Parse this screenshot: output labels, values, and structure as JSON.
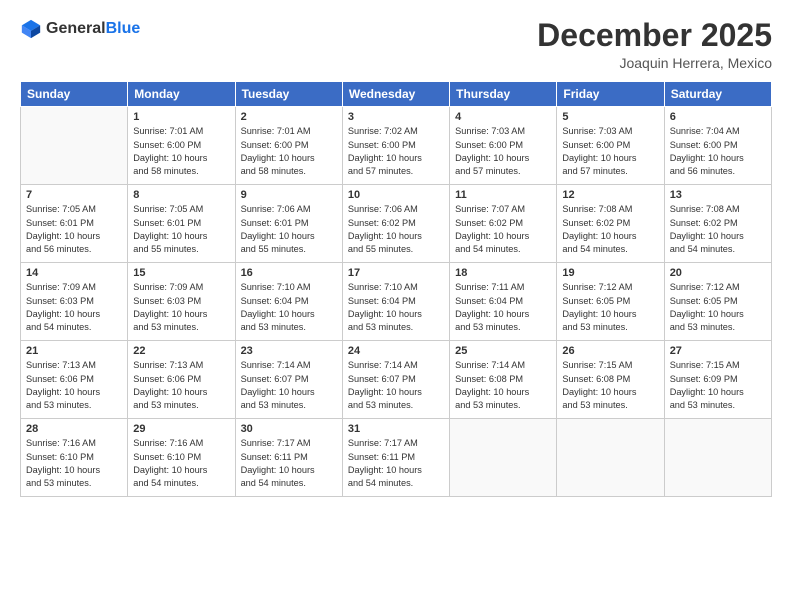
{
  "logo": {
    "general": "General",
    "blue": "Blue"
  },
  "title": "December 2025",
  "subtitle": "Joaquin Herrera, Mexico",
  "weekdays": [
    "Sunday",
    "Monday",
    "Tuesday",
    "Wednesday",
    "Thursday",
    "Friday",
    "Saturday"
  ],
  "weeks": [
    [
      {
        "day": "",
        "info": ""
      },
      {
        "day": "1",
        "info": "Sunrise: 7:01 AM\nSunset: 6:00 PM\nDaylight: 10 hours\nand 58 minutes."
      },
      {
        "day": "2",
        "info": "Sunrise: 7:01 AM\nSunset: 6:00 PM\nDaylight: 10 hours\nand 58 minutes."
      },
      {
        "day": "3",
        "info": "Sunrise: 7:02 AM\nSunset: 6:00 PM\nDaylight: 10 hours\nand 57 minutes."
      },
      {
        "day": "4",
        "info": "Sunrise: 7:03 AM\nSunset: 6:00 PM\nDaylight: 10 hours\nand 57 minutes."
      },
      {
        "day": "5",
        "info": "Sunrise: 7:03 AM\nSunset: 6:00 PM\nDaylight: 10 hours\nand 57 minutes."
      },
      {
        "day": "6",
        "info": "Sunrise: 7:04 AM\nSunset: 6:00 PM\nDaylight: 10 hours\nand 56 minutes."
      }
    ],
    [
      {
        "day": "7",
        "info": "Sunrise: 7:05 AM\nSunset: 6:01 PM\nDaylight: 10 hours\nand 56 minutes."
      },
      {
        "day": "8",
        "info": "Sunrise: 7:05 AM\nSunset: 6:01 PM\nDaylight: 10 hours\nand 55 minutes."
      },
      {
        "day": "9",
        "info": "Sunrise: 7:06 AM\nSunset: 6:01 PM\nDaylight: 10 hours\nand 55 minutes."
      },
      {
        "day": "10",
        "info": "Sunrise: 7:06 AM\nSunset: 6:02 PM\nDaylight: 10 hours\nand 55 minutes."
      },
      {
        "day": "11",
        "info": "Sunrise: 7:07 AM\nSunset: 6:02 PM\nDaylight: 10 hours\nand 54 minutes."
      },
      {
        "day": "12",
        "info": "Sunrise: 7:08 AM\nSunset: 6:02 PM\nDaylight: 10 hours\nand 54 minutes."
      },
      {
        "day": "13",
        "info": "Sunrise: 7:08 AM\nSunset: 6:02 PM\nDaylight: 10 hours\nand 54 minutes."
      }
    ],
    [
      {
        "day": "14",
        "info": "Sunrise: 7:09 AM\nSunset: 6:03 PM\nDaylight: 10 hours\nand 54 minutes."
      },
      {
        "day": "15",
        "info": "Sunrise: 7:09 AM\nSunset: 6:03 PM\nDaylight: 10 hours\nand 53 minutes."
      },
      {
        "day": "16",
        "info": "Sunrise: 7:10 AM\nSunset: 6:04 PM\nDaylight: 10 hours\nand 53 minutes."
      },
      {
        "day": "17",
        "info": "Sunrise: 7:10 AM\nSunset: 6:04 PM\nDaylight: 10 hours\nand 53 minutes."
      },
      {
        "day": "18",
        "info": "Sunrise: 7:11 AM\nSunset: 6:04 PM\nDaylight: 10 hours\nand 53 minutes."
      },
      {
        "day": "19",
        "info": "Sunrise: 7:12 AM\nSunset: 6:05 PM\nDaylight: 10 hours\nand 53 minutes."
      },
      {
        "day": "20",
        "info": "Sunrise: 7:12 AM\nSunset: 6:05 PM\nDaylight: 10 hours\nand 53 minutes."
      }
    ],
    [
      {
        "day": "21",
        "info": "Sunrise: 7:13 AM\nSunset: 6:06 PM\nDaylight: 10 hours\nand 53 minutes."
      },
      {
        "day": "22",
        "info": "Sunrise: 7:13 AM\nSunset: 6:06 PM\nDaylight: 10 hours\nand 53 minutes."
      },
      {
        "day": "23",
        "info": "Sunrise: 7:14 AM\nSunset: 6:07 PM\nDaylight: 10 hours\nand 53 minutes."
      },
      {
        "day": "24",
        "info": "Sunrise: 7:14 AM\nSunset: 6:07 PM\nDaylight: 10 hours\nand 53 minutes."
      },
      {
        "day": "25",
        "info": "Sunrise: 7:14 AM\nSunset: 6:08 PM\nDaylight: 10 hours\nand 53 minutes."
      },
      {
        "day": "26",
        "info": "Sunrise: 7:15 AM\nSunset: 6:08 PM\nDaylight: 10 hours\nand 53 minutes."
      },
      {
        "day": "27",
        "info": "Sunrise: 7:15 AM\nSunset: 6:09 PM\nDaylight: 10 hours\nand 53 minutes."
      }
    ],
    [
      {
        "day": "28",
        "info": "Sunrise: 7:16 AM\nSunset: 6:10 PM\nDaylight: 10 hours\nand 53 minutes."
      },
      {
        "day": "29",
        "info": "Sunrise: 7:16 AM\nSunset: 6:10 PM\nDaylight: 10 hours\nand 54 minutes."
      },
      {
        "day": "30",
        "info": "Sunrise: 7:17 AM\nSunset: 6:11 PM\nDaylight: 10 hours\nand 54 minutes."
      },
      {
        "day": "31",
        "info": "Sunrise: 7:17 AM\nSunset: 6:11 PM\nDaylight: 10 hours\nand 54 minutes."
      },
      {
        "day": "",
        "info": ""
      },
      {
        "day": "",
        "info": ""
      },
      {
        "day": "",
        "info": ""
      }
    ]
  ]
}
